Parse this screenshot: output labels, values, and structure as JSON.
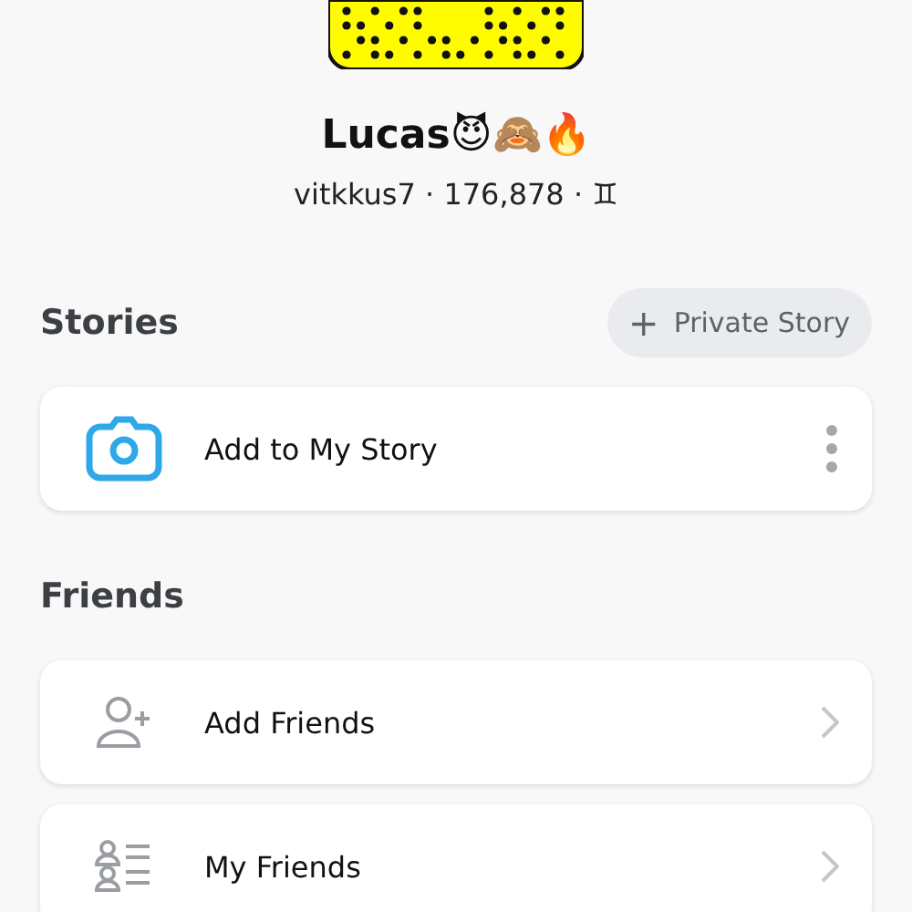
{
  "profile": {
    "name": "Lucas😈🙈🔥",
    "subtitle": "vitkkus7 · 176,878 · ♊"
  },
  "stories": {
    "title": "Stories",
    "action": {
      "icon": "+",
      "label": "Private Story"
    },
    "items": [
      {
        "label": "Add to My Story",
        "kind": "story"
      }
    ]
  },
  "friends": {
    "title": "Friends",
    "items": [
      {
        "label": "Add Friends",
        "kind": "add"
      },
      {
        "label": "My Friends",
        "kind": "list"
      }
    ]
  }
}
